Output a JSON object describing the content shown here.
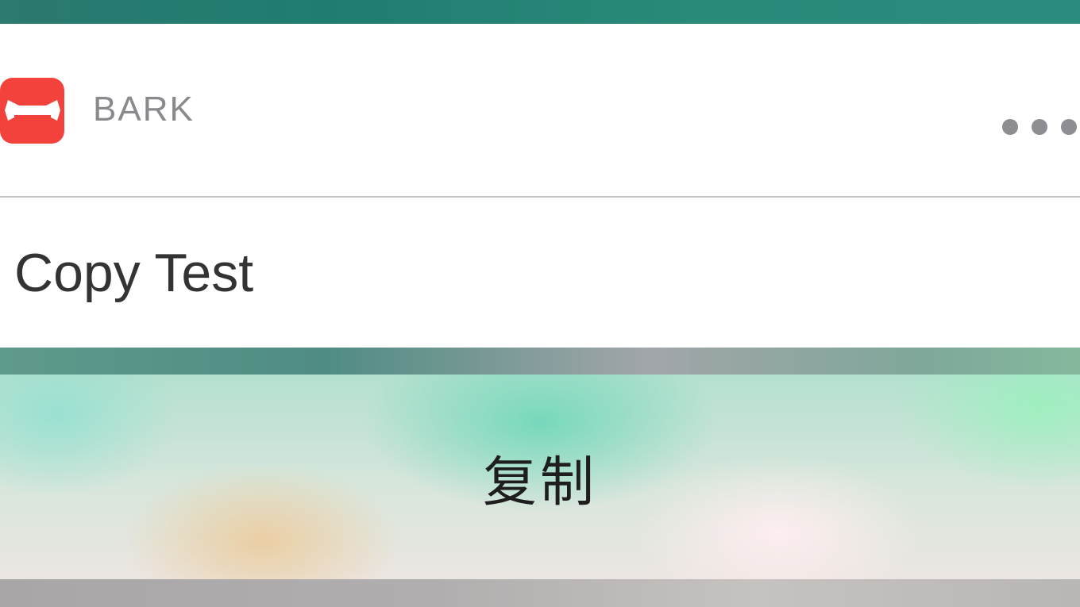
{
  "notification": {
    "app_name": "BARK",
    "app_icon": "bark-app-icon",
    "app_icon_color": "#f2423b",
    "more_icon": "ellipsis-icon",
    "message": "Copy Test"
  },
  "action": {
    "label": "复制"
  }
}
